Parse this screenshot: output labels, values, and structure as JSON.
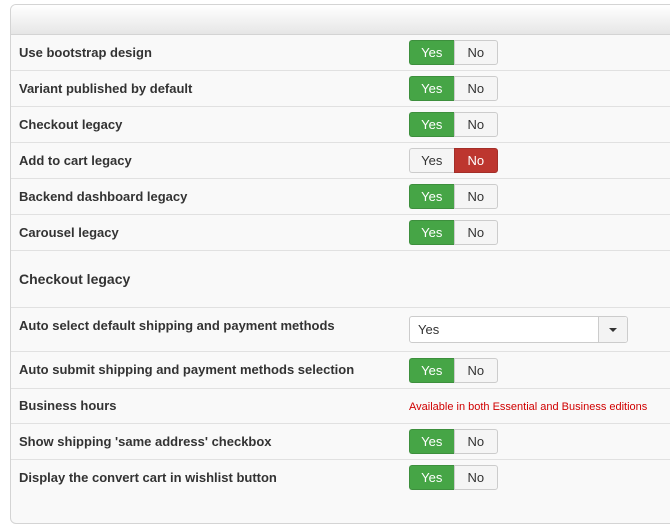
{
  "settings": [
    {
      "label": "Use bootstrap design",
      "yes": "Yes",
      "no": "No",
      "value": "yes"
    },
    {
      "label": "Variant published by default",
      "yes": "Yes",
      "no": "No",
      "value": "yes"
    },
    {
      "label": "Checkout legacy",
      "yes": "Yes",
      "no": "No",
      "value": "yes"
    },
    {
      "label": "Add to cart legacy",
      "yes": "Yes",
      "no": "No",
      "value": "no"
    },
    {
      "label": "Backend dashboard legacy",
      "yes": "Yes",
      "no": "No",
      "value": "yes"
    },
    {
      "label": "Carousel legacy",
      "yes": "Yes",
      "no": "No",
      "value": "yes"
    }
  ],
  "section": {
    "title": "Checkout legacy"
  },
  "checkout": {
    "auto_select": {
      "label": "Auto select default shipping and payment methods",
      "selected": "Yes"
    },
    "auto_submit": {
      "label": "Auto submit shipping and payment methods selection",
      "yes": "Yes",
      "no": "No",
      "value": "yes"
    },
    "business_hours": {
      "label": "Business hours",
      "note": "Available in both Essential and Business editions"
    },
    "same_address": {
      "label": "Show shipping 'same address' checkbox",
      "yes": "Yes",
      "no": "No",
      "value": "yes"
    },
    "convert_cart": {
      "label": "Display the convert cart in wishlist button",
      "yes": "Yes",
      "no": "No",
      "value": "yes"
    }
  },
  "colors": {
    "yes_active": "#46a546",
    "no_active": "#bd362f",
    "note_text": "#d00000"
  }
}
